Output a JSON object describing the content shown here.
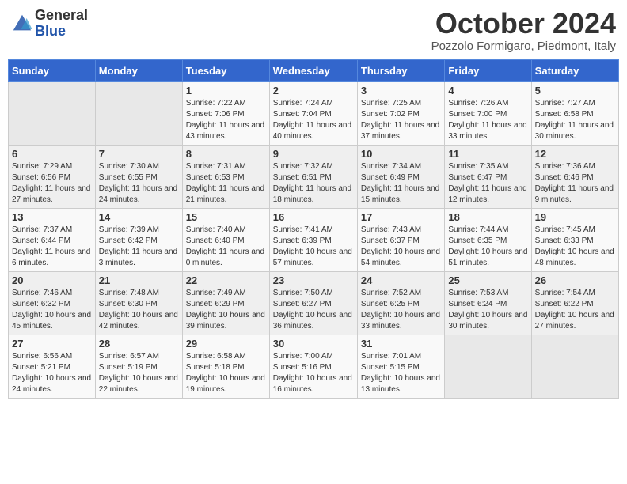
{
  "header": {
    "logo_general": "General",
    "logo_blue": "Blue",
    "month_title": "October 2024",
    "subtitle": "Pozzolo Formigaro, Piedmont, Italy"
  },
  "days_of_week": [
    "Sunday",
    "Monday",
    "Tuesday",
    "Wednesday",
    "Thursday",
    "Friday",
    "Saturday"
  ],
  "weeks": [
    [
      {
        "day": "",
        "sunrise": "",
        "sunset": "",
        "daylight": ""
      },
      {
        "day": "",
        "sunrise": "",
        "sunset": "",
        "daylight": ""
      },
      {
        "day": "1",
        "sunrise": "Sunrise: 7:22 AM",
        "sunset": "Sunset: 7:06 PM",
        "daylight": "Daylight: 11 hours and 43 minutes."
      },
      {
        "day": "2",
        "sunrise": "Sunrise: 7:24 AM",
        "sunset": "Sunset: 7:04 PM",
        "daylight": "Daylight: 11 hours and 40 minutes."
      },
      {
        "day": "3",
        "sunrise": "Sunrise: 7:25 AM",
        "sunset": "Sunset: 7:02 PM",
        "daylight": "Daylight: 11 hours and 37 minutes."
      },
      {
        "day": "4",
        "sunrise": "Sunrise: 7:26 AM",
        "sunset": "Sunset: 7:00 PM",
        "daylight": "Daylight: 11 hours and 33 minutes."
      },
      {
        "day": "5",
        "sunrise": "Sunrise: 7:27 AM",
        "sunset": "Sunset: 6:58 PM",
        "daylight": "Daylight: 11 hours and 30 minutes."
      }
    ],
    [
      {
        "day": "6",
        "sunrise": "Sunrise: 7:29 AM",
        "sunset": "Sunset: 6:56 PM",
        "daylight": "Daylight: 11 hours and 27 minutes."
      },
      {
        "day": "7",
        "sunrise": "Sunrise: 7:30 AM",
        "sunset": "Sunset: 6:55 PM",
        "daylight": "Daylight: 11 hours and 24 minutes."
      },
      {
        "day": "8",
        "sunrise": "Sunrise: 7:31 AM",
        "sunset": "Sunset: 6:53 PM",
        "daylight": "Daylight: 11 hours and 21 minutes."
      },
      {
        "day": "9",
        "sunrise": "Sunrise: 7:32 AM",
        "sunset": "Sunset: 6:51 PM",
        "daylight": "Daylight: 11 hours and 18 minutes."
      },
      {
        "day": "10",
        "sunrise": "Sunrise: 7:34 AM",
        "sunset": "Sunset: 6:49 PM",
        "daylight": "Daylight: 11 hours and 15 minutes."
      },
      {
        "day": "11",
        "sunrise": "Sunrise: 7:35 AM",
        "sunset": "Sunset: 6:47 PM",
        "daylight": "Daylight: 11 hours and 12 minutes."
      },
      {
        "day": "12",
        "sunrise": "Sunrise: 7:36 AM",
        "sunset": "Sunset: 6:46 PM",
        "daylight": "Daylight: 11 hours and 9 minutes."
      }
    ],
    [
      {
        "day": "13",
        "sunrise": "Sunrise: 7:37 AM",
        "sunset": "Sunset: 6:44 PM",
        "daylight": "Daylight: 11 hours and 6 minutes."
      },
      {
        "day": "14",
        "sunrise": "Sunrise: 7:39 AM",
        "sunset": "Sunset: 6:42 PM",
        "daylight": "Daylight: 11 hours and 3 minutes."
      },
      {
        "day": "15",
        "sunrise": "Sunrise: 7:40 AM",
        "sunset": "Sunset: 6:40 PM",
        "daylight": "Daylight: 11 hours and 0 minutes."
      },
      {
        "day": "16",
        "sunrise": "Sunrise: 7:41 AM",
        "sunset": "Sunset: 6:39 PM",
        "daylight": "Daylight: 10 hours and 57 minutes."
      },
      {
        "day": "17",
        "sunrise": "Sunrise: 7:43 AM",
        "sunset": "Sunset: 6:37 PM",
        "daylight": "Daylight: 10 hours and 54 minutes."
      },
      {
        "day": "18",
        "sunrise": "Sunrise: 7:44 AM",
        "sunset": "Sunset: 6:35 PM",
        "daylight": "Daylight: 10 hours and 51 minutes."
      },
      {
        "day": "19",
        "sunrise": "Sunrise: 7:45 AM",
        "sunset": "Sunset: 6:33 PM",
        "daylight": "Daylight: 10 hours and 48 minutes."
      }
    ],
    [
      {
        "day": "20",
        "sunrise": "Sunrise: 7:46 AM",
        "sunset": "Sunset: 6:32 PM",
        "daylight": "Daylight: 10 hours and 45 minutes."
      },
      {
        "day": "21",
        "sunrise": "Sunrise: 7:48 AM",
        "sunset": "Sunset: 6:30 PM",
        "daylight": "Daylight: 10 hours and 42 minutes."
      },
      {
        "day": "22",
        "sunrise": "Sunrise: 7:49 AM",
        "sunset": "Sunset: 6:29 PM",
        "daylight": "Daylight: 10 hours and 39 minutes."
      },
      {
        "day": "23",
        "sunrise": "Sunrise: 7:50 AM",
        "sunset": "Sunset: 6:27 PM",
        "daylight": "Daylight: 10 hours and 36 minutes."
      },
      {
        "day": "24",
        "sunrise": "Sunrise: 7:52 AM",
        "sunset": "Sunset: 6:25 PM",
        "daylight": "Daylight: 10 hours and 33 minutes."
      },
      {
        "day": "25",
        "sunrise": "Sunrise: 7:53 AM",
        "sunset": "Sunset: 6:24 PM",
        "daylight": "Daylight: 10 hours and 30 minutes."
      },
      {
        "day": "26",
        "sunrise": "Sunrise: 7:54 AM",
        "sunset": "Sunset: 6:22 PM",
        "daylight": "Daylight: 10 hours and 27 minutes."
      }
    ],
    [
      {
        "day": "27",
        "sunrise": "Sunrise: 6:56 AM",
        "sunset": "Sunset: 5:21 PM",
        "daylight": "Daylight: 10 hours and 24 minutes."
      },
      {
        "day": "28",
        "sunrise": "Sunrise: 6:57 AM",
        "sunset": "Sunset: 5:19 PM",
        "daylight": "Daylight: 10 hours and 22 minutes."
      },
      {
        "day": "29",
        "sunrise": "Sunrise: 6:58 AM",
        "sunset": "Sunset: 5:18 PM",
        "daylight": "Daylight: 10 hours and 19 minutes."
      },
      {
        "day": "30",
        "sunrise": "Sunrise: 7:00 AM",
        "sunset": "Sunset: 5:16 PM",
        "daylight": "Daylight: 10 hours and 16 minutes."
      },
      {
        "day": "31",
        "sunrise": "Sunrise: 7:01 AM",
        "sunset": "Sunset: 5:15 PM",
        "daylight": "Daylight: 10 hours and 13 minutes."
      },
      {
        "day": "",
        "sunrise": "",
        "sunset": "",
        "daylight": ""
      },
      {
        "day": "",
        "sunrise": "",
        "sunset": "",
        "daylight": ""
      }
    ]
  ]
}
